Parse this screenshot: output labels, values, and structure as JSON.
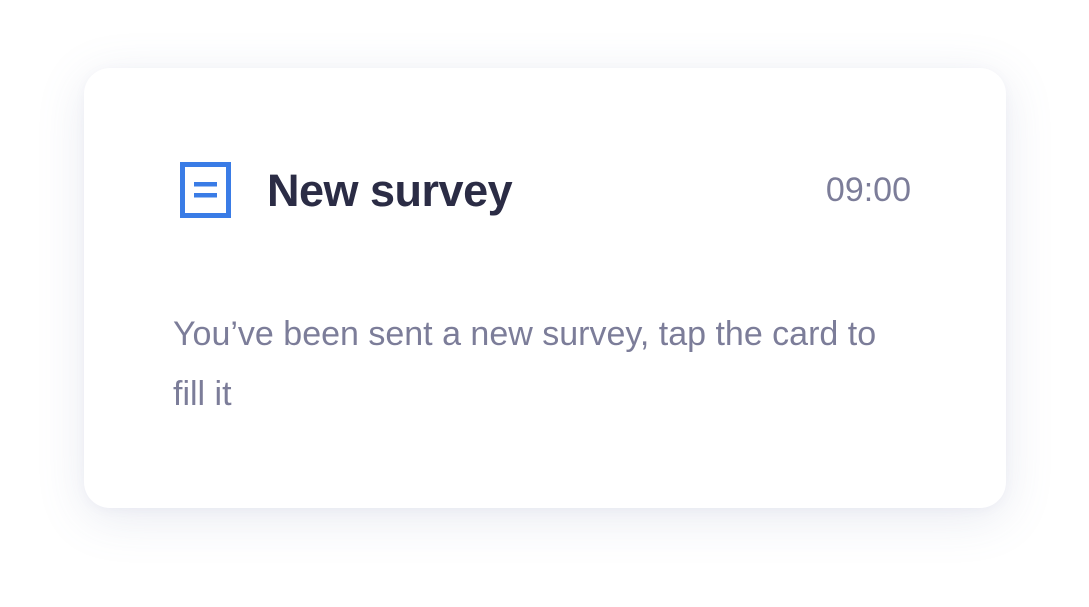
{
  "notification": {
    "icon": "document-icon",
    "title": "New survey",
    "time": "09:00",
    "message": "You’ve been sent a new survey, tap the card to fill it"
  },
  "colors": {
    "accent": "#3A7CE6",
    "title": "#2B2C45",
    "secondary_text": "#7C7D99",
    "card_background": "#FFFFFF"
  }
}
